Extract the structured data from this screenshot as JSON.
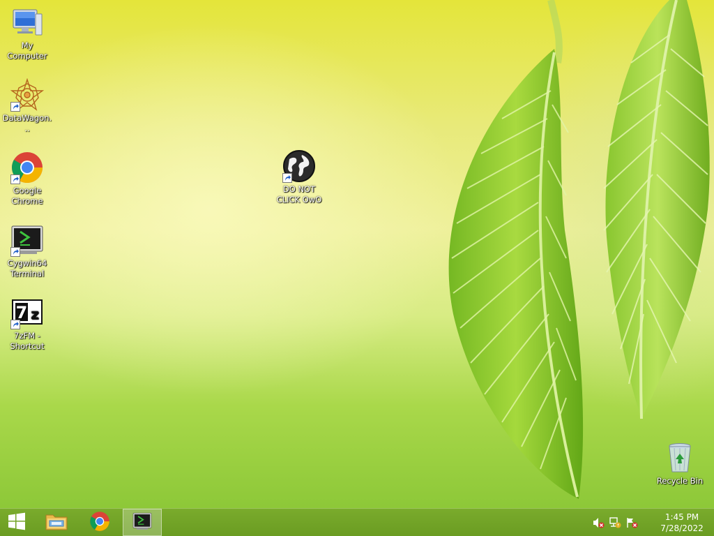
{
  "desktop": {
    "icons": [
      {
        "label": "My Computer",
        "icon": "computer-icon"
      },
      {
        "label": "DataWagon...",
        "icon": "datawagon-icon"
      },
      {
        "label": "Google Chrome",
        "icon": "chrome-icon"
      },
      {
        "label": "Cygwin64 Terminal",
        "icon": "terminal-icon"
      },
      {
        "label": "7zFM - Shortcut",
        "icon": "7zip-icon"
      },
      {
        "label": "DO NOT CLICK OwO",
        "icon": "globe-icon"
      },
      {
        "label": "Recycle Bin",
        "icon": "recycle-bin-icon"
      }
    ]
  },
  "taskbar": {
    "start": {
      "icon": "windows-logo-icon"
    },
    "pinned": [
      {
        "name": "File Explorer",
        "icon": "folder-icon"
      },
      {
        "name": "Google Chrome",
        "icon": "chrome-icon"
      },
      {
        "name": "Cygwin64 Terminal",
        "icon": "terminal-icon",
        "active": true
      }
    ],
    "tray": {
      "icons": [
        "volume-muted-icon",
        "network-icon",
        "action-center-flag-icon"
      ],
      "time": "1:45 PM",
      "date": "7/28/2022"
    }
  },
  "colors": {
    "taskbar": "#6a9c22",
    "wallpaper_top": "#e4e53a",
    "wallpaper_bottom": "#8dc838"
  }
}
